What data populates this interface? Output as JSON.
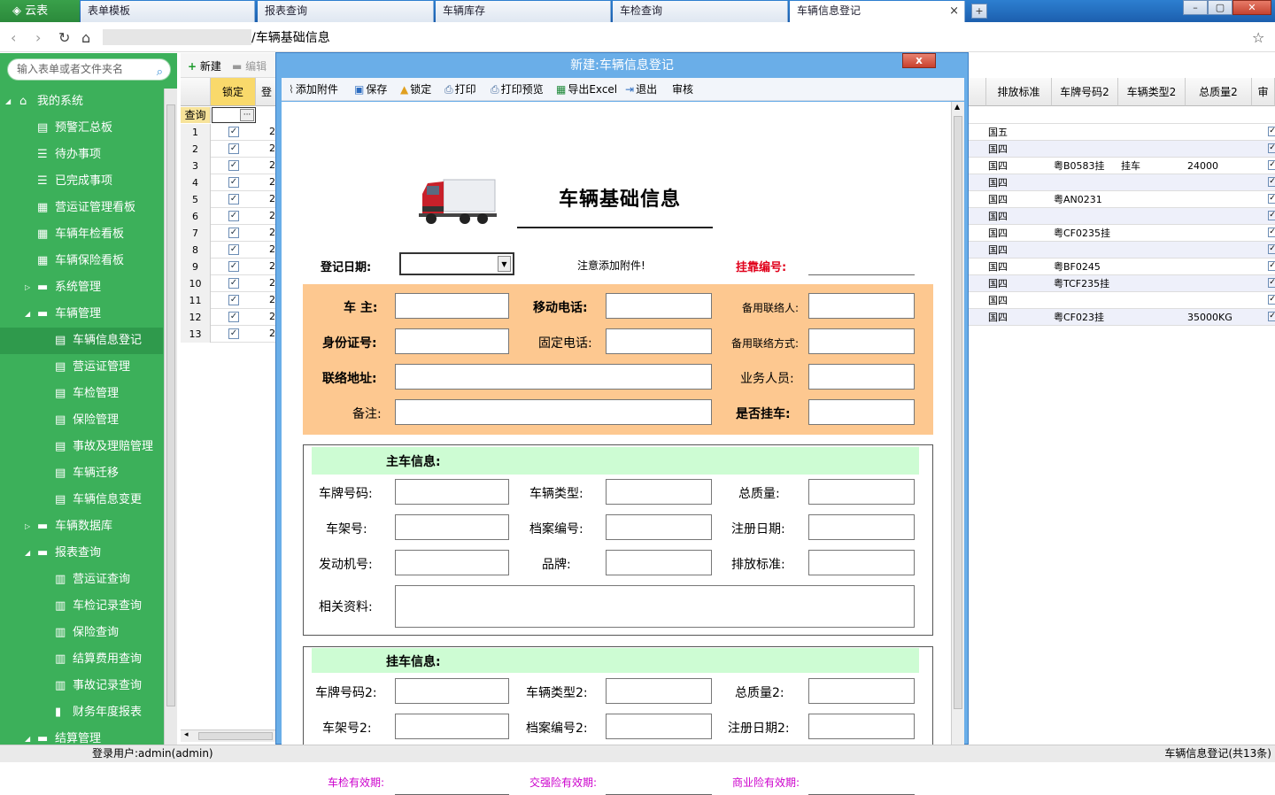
{
  "tabs": [
    {
      "label": "云表"
    },
    {
      "label": "表单模板"
    },
    {
      "label": "报表查询"
    },
    {
      "label": "车辆库存"
    },
    {
      "label": "车检查询"
    },
    {
      "label": "车辆信息登记"
    }
  ],
  "address": {
    "text": "/车辆基础信息"
  },
  "sidebar": {
    "search_placeholder": "输入表单或者文件夹名",
    "items": [
      {
        "label": "我的系统"
      },
      {
        "label": "预警汇总板"
      },
      {
        "label": "待办事项"
      },
      {
        "label": "已完成事项"
      },
      {
        "label": "营运证管理看板"
      },
      {
        "label": "车辆年检看板"
      },
      {
        "label": "车辆保险看板"
      },
      {
        "label": "系统管理"
      },
      {
        "label": "车辆管理"
      },
      {
        "label": "车辆信息登记"
      },
      {
        "label": "营运证管理"
      },
      {
        "label": "车检管理"
      },
      {
        "label": "保险管理"
      },
      {
        "label": "事故及理赔管理"
      },
      {
        "label": "车辆迁移"
      },
      {
        "label": "车辆信息变更"
      },
      {
        "label": "车辆数据库"
      },
      {
        "label": "报表查询"
      },
      {
        "label": "营运证查询"
      },
      {
        "label": "车检记录查询"
      },
      {
        "label": "保险查询"
      },
      {
        "label": "结算费用查询"
      },
      {
        "label": "事故记录查询"
      },
      {
        "label": "财务年度报表"
      },
      {
        "label": "结算管理"
      }
    ]
  },
  "bg_toolbar": {
    "new": "新建",
    "edit": "编辑"
  },
  "left_grid": {
    "col_lock": "锁定",
    "col_next": "登",
    "query": "查询",
    "ellipsis": "···",
    "rows": [
      "1",
      "2",
      "3",
      "4",
      "5",
      "6",
      "7",
      "8",
      "9",
      "10",
      "11",
      "12",
      "13"
    ],
    "cell_value": "2"
  },
  "right_grid": {
    "headers": [
      "排放标准",
      "车牌号码2",
      "车辆类型2",
      "总质量2",
      "审"
    ],
    "rows": [
      {
        "emission": "国五",
        "plate": "",
        "type": "",
        "mass": ""
      },
      {
        "emission": "国四",
        "plate": "",
        "type": "",
        "mass": ""
      },
      {
        "emission": "国四",
        "plate": "粤B0583挂",
        "type": "挂车",
        "mass": "24000"
      },
      {
        "emission": "国四",
        "plate": "",
        "type": "",
        "mass": ""
      },
      {
        "emission": "国四",
        "plate": "粤AN0231",
        "type": "",
        "mass": ""
      },
      {
        "emission": "国四",
        "plate": "",
        "type": "",
        "mass": ""
      },
      {
        "emission": "国四",
        "plate": "粤CF0235挂",
        "type": "",
        "mass": ""
      },
      {
        "emission": "国四",
        "plate": "",
        "type": "",
        "mass": ""
      },
      {
        "emission": "国四",
        "plate": "粤BF0245",
        "type": "",
        "mass": ""
      },
      {
        "emission": "国四",
        "plate": "粤TCF235挂",
        "type": "",
        "mass": ""
      },
      {
        "emission": "国四",
        "plate": "",
        "type": "",
        "mass": ""
      },
      {
        "emission": "国四",
        "plate": "粤CF023挂",
        "type": "",
        "mass": "35000KG"
      }
    ]
  },
  "dialog": {
    "title": "新建:车辆信息登记",
    "close": "x",
    "toolbar": [
      "添加附件",
      "保存",
      "锁定",
      "打印",
      "打印预览",
      "导出Excel",
      "退出",
      "审核"
    ],
    "form_title": "车辆基础信息",
    "reg_date": "登记日期:",
    "note": "注意添加附件!",
    "trailer_no": "挂靠编号:",
    "owner": {
      "owner": "车  主:",
      "mobile": "移动电话:",
      "backup_contact": "备用联络人:",
      "id_no": "身份证号:",
      "phone": "固定电话:",
      "backup_method": "备用联络方式:",
      "address": "联络地址:",
      "sales": "业务人员:",
      "remark": "备注:",
      "is_trailer": "是否挂车:"
    },
    "main": {
      "title": "主车信息:",
      "plate": "车牌号码:",
      "vtype": "车辆类型:",
      "mass": "总质量:",
      "frame": "车架号:",
      "file_no": "档案编号:",
      "reg_date": "注册日期:",
      "engine": "发动机号:",
      "brand": "品牌:",
      "emission": "排放标准:",
      "docs": "相关资料:"
    },
    "trailer": {
      "title": "挂车信息:",
      "plate": "车牌号码2:",
      "vtype": "车辆类型2:",
      "mass": "总质量2:",
      "frame": "车架号2:",
      "file_no": "档案编号2:",
      "reg_date": "注册日期2:"
    },
    "validity": {
      "inspect": "车检有效期:",
      "compulsory": "交强险有效期:",
      "commercial": "商业险有效期:"
    }
  },
  "status": {
    "user": "登录用户:admin(admin)",
    "right": "车辆信息登记(共13条)"
  },
  "colors": {
    "sidebar": "#3cb05a",
    "accent": "#1c5fae",
    "orange": "#fdc890",
    "green_header": "#cdfcd3",
    "red_label": "#e0001b",
    "magenta_label": "#cc00cc"
  }
}
